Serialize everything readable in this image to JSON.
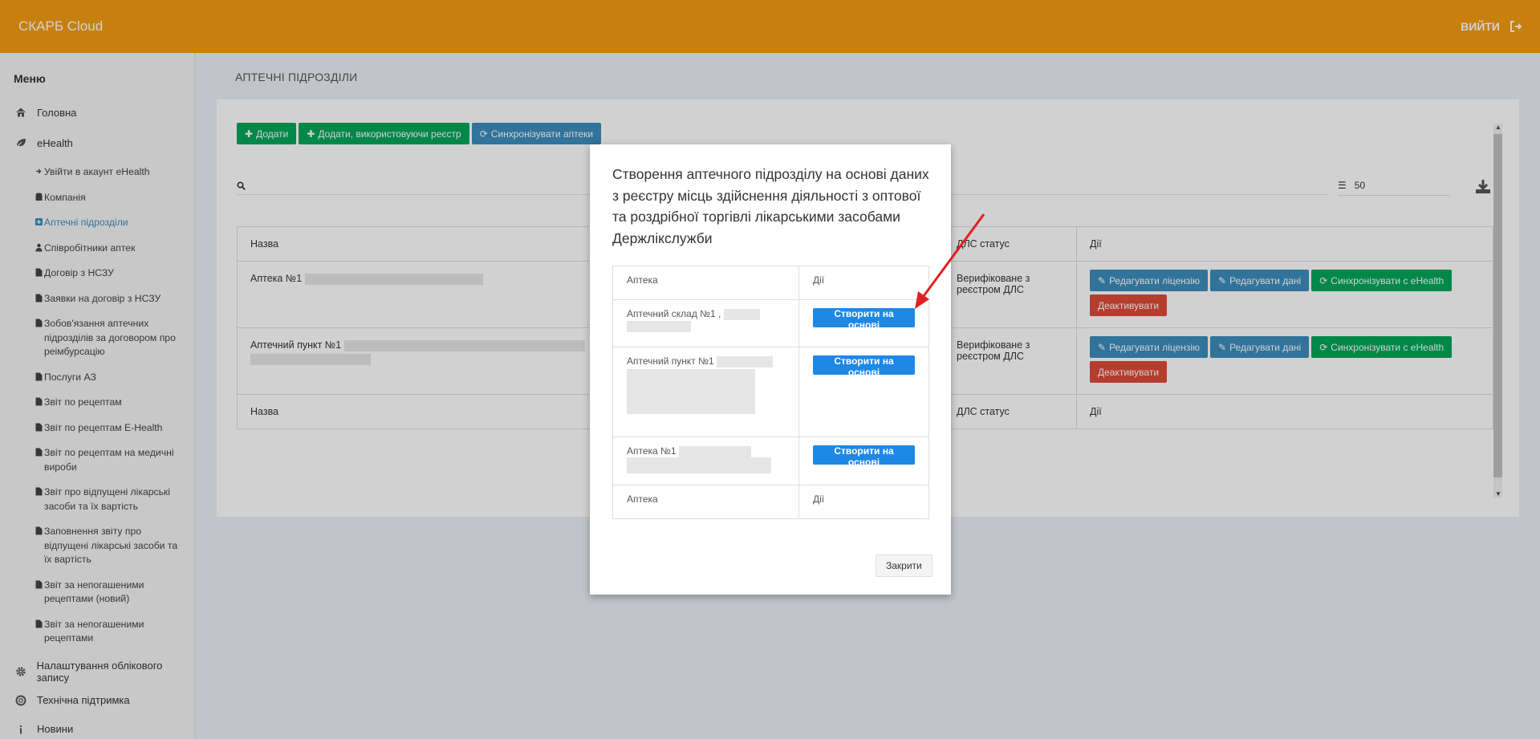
{
  "app": {
    "brand": "СКАРБ Cloud",
    "logout_label": "ВИЙТИ"
  },
  "sidebar": {
    "menu_title": "Меню",
    "home": "Головна",
    "ehealth": "eHealth",
    "subitems": [
      "Увійти в акаунт eHealth",
      "Компанія",
      "Аптечні підрозділи",
      "Співробітники аптек",
      "Договір з НСЗУ",
      "Заявки на договір з НСЗУ",
      "Зобов'язання аптечних підрозділів за договором про реімбурсацію",
      "Послуги АЗ",
      "Звіт по рецептам",
      "Звіт по рецептам E-Health",
      "Звіт по рецептам на медичні вироби",
      "Звіт про відпущені лікарські засоби та їх вартість",
      "Заповнення звіту про відпущені лікарські засоби та їх вартість",
      "Звіт за непогашеними рецептами (новий)",
      "Звіт за непогашеними рецептами"
    ],
    "settings": "Налаштування облікового запису",
    "support": "Технічна підтримка",
    "news": "Новини"
  },
  "page": {
    "title": "АПТЕЧНІ ПІДРОЗДІЛИ",
    "toolbar": {
      "add": "Додати",
      "add_registry": "Додати, використовуючи реєстр",
      "sync": "Синхронізувати аптеки"
    },
    "per_page": "50",
    "table": {
      "headers": {
        "name": "Назва",
        "dls_status": "ДЛС статус",
        "actions": "Дії"
      },
      "rows": [
        {
          "name": "Аптека №1",
          "status": "Верифіковане з реєстром ДЛС"
        },
        {
          "name": "Аптечний пункт №1",
          "status": "Верифіковане з реєстром ДЛС"
        }
      ],
      "row_actions": {
        "edit_license": "Редагувати ліцензію",
        "edit_data": "Редагувати дані",
        "sync_ehealth": "Синхронізувати с eHealth",
        "deactivate": "Деактивувати"
      }
    }
  },
  "modal": {
    "title": "Створення аптечного підрозділу на основі даних з реєстру місць здійснення діяльності з оптової та роздрібної торгівлі лікарськими засобами Держлікслужби",
    "col_pharmacy": "Аптека",
    "col_actions": "Дії",
    "rows": [
      {
        "name": "Аптечний склад №1 ,"
      },
      {
        "name": "Аптечний пункт №1"
      },
      {
        "name": "Аптека №1"
      }
    ],
    "create_label": "Створити на основі",
    "close_label": "Закрити"
  }
}
